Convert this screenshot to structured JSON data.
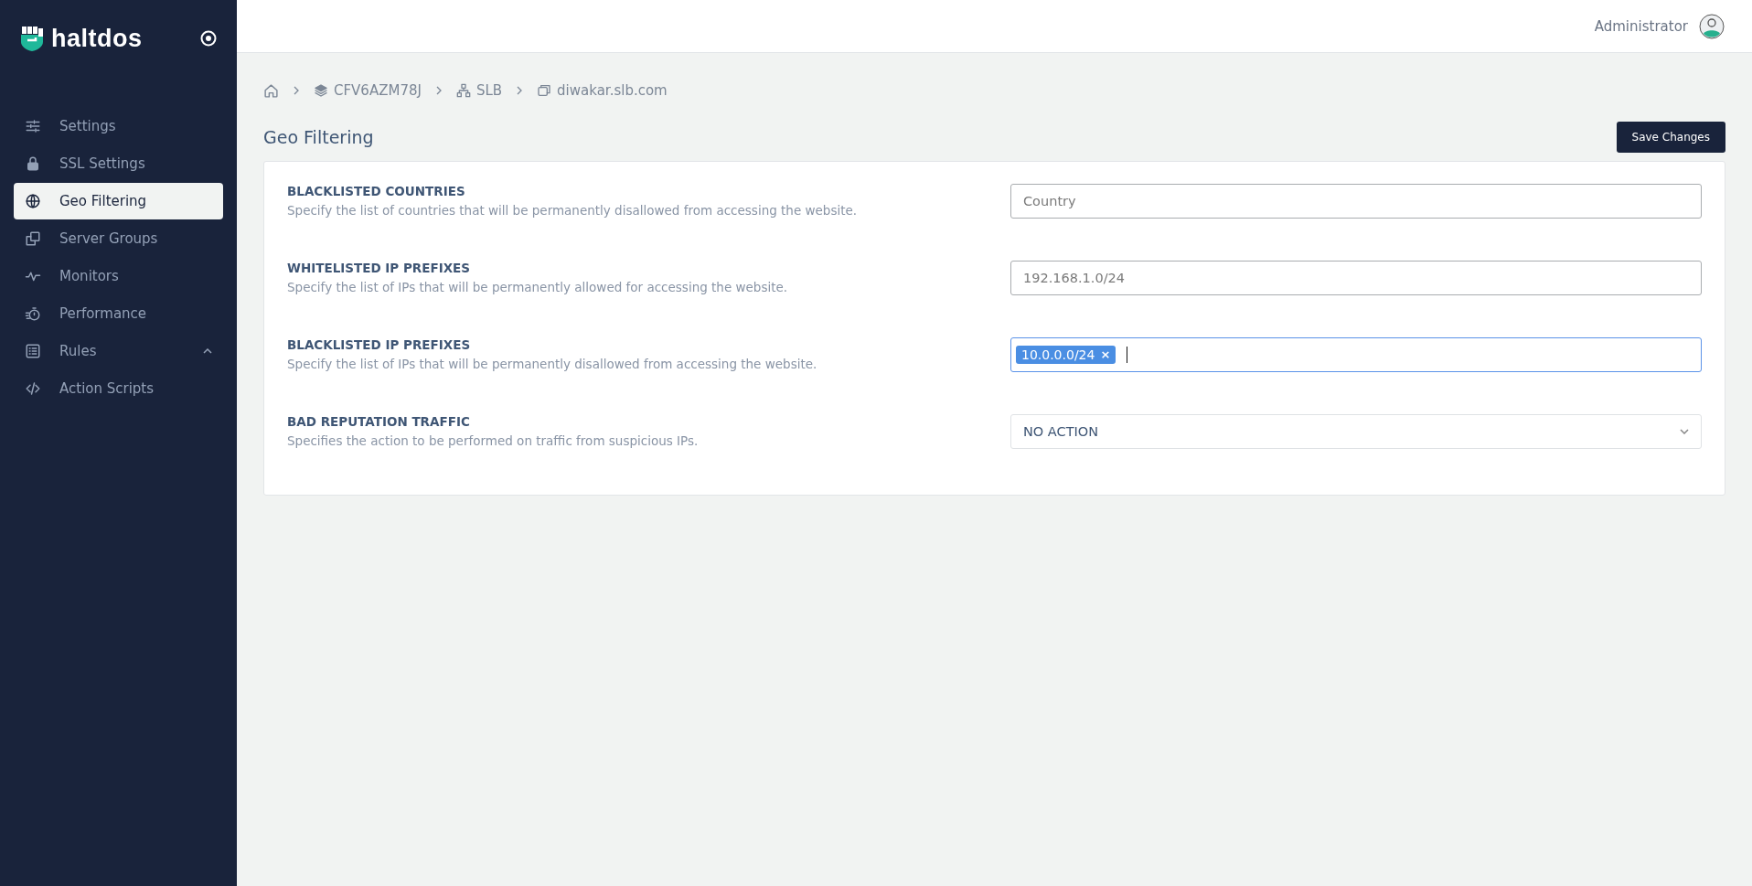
{
  "sidebar": {
    "brand": "haltdos",
    "items": [
      {
        "label": "Settings",
        "kind": "link",
        "selected": false
      },
      {
        "label": "SSL Settings",
        "kind": "link",
        "selected": false
      },
      {
        "label": "Geo Filtering",
        "kind": "link",
        "selected": true
      },
      {
        "label": "Server Groups",
        "kind": "link",
        "selected": false
      },
      {
        "label": "Monitors",
        "kind": "link",
        "selected": false
      },
      {
        "label": "Performance",
        "kind": "link",
        "selected": false
      },
      {
        "label": "Rules",
        "kind": "group",
        "selected": false
      },
      {
        "label": "Action Scripts",
        "kind": "link",
        "selected": false
      }
    ]
  },
  "header": {
    "user": "Administrator"
  },
  "breadcrumb": [
    {
      "kind": "home"
    },
    {
      "kind": "stack",
      "label": "CFV6AZM78J"
    },
    {
      "kind": "network",
      "label": "SLB"
    },
    {
      "kind": "window",
      "label": "diwakar.slb.com"
    }
  ],
  "page": {
    "title": "Geo Filtering",
    "save_button": "Save Changes"
  },
  "fields": [
    {
      "kind": "text",
      "label": "BLACKLISTED COUNTRIES",
      "description": "Specify the list of countries that will be permanently disallowed from accessing the website.",
      "placeholder": "Country",
      "focused": false
    },
    {
      "kind": "text",
      "label": "WHITELISTED IP PREFIXES",
      "description": "Specify the list of IPs that will be permanently allowed for accessing the website.",
      "placeholder": "192.168.1.0/24",
      "focused": false
    },
    {
      "kind": "tags",
      "label": "BLACKLISTED IP PREFIXES",
      "description": "Specify the list of IPs that will be permanently disallowed from accessing the website.",
      "tags": [
        {
          "text": "10.0.0.0/24",
          "remove": "×"
        }
      ],
      "focused": true
    },
    {
      "kind": "select",
      "label": "BAD REPUTATION TRAFFIC",
      "description": "Specifies the action to be performed on traffic from suspicious IPs.",
      "value": "NO ACTION",
      "focused": false
    }
  ]
}
